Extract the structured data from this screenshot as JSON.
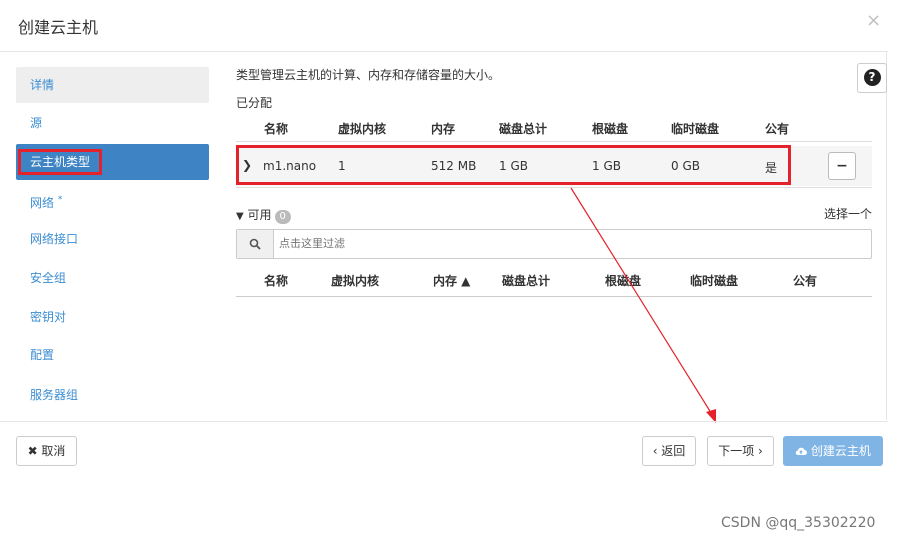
{
  "modal": {
    "title": "创建云主机",
    "close_icon": "×"
  },
  "sidebar": {
    "items": [
      {
        "label": "详情"
      },
      {
        "label": "源"
      },
      {
        "label": "云主机类型"
      },
      {
        "label": "网络",
        "required_mark": "*"
      },
      {
        "label": "网络接口"
      },
      {
        "label": "安全组"
      },
      {
        "label": "密钥对"
      },
      {
        "label": "配置"
      },
      {
        "label": "服务器组"
      }
    ]
  },
  "main": {
    "description": "类型管理云主机的计算、内存和存储容量的大小。",
    "help_glyph": "?",
    "allocated": {
      "label": "已分配",
      "columns": [
        "名称",
        "虚拟内核",
        "内存",
        "磁盘总计",
        "根磁盘",
        "临时磁盘",
        "公有"
      ],
      "row": {
        "expand": "❯",
        "name": "m1.nano",
        "vcpus": "1",
        "ram": "512 MB",
        "total_disk": "1 GB",
        "root_disk": "1 GB",
        "ephemeral_disk": "0 GB",
        "public": "是",
        "remove": "−"
      }
    },
    "available": {
      "toggle": "可用",
      "count": "0",
      "pick_hint": "选择一个",
      "search_placeholder": "点击这里过滤",
      "columns": [
        "名称",
        "虚拟内核",
        "内存 ▲",
        "磁盘总计",
        "根磁盘",
        "临时磁盘",
        "公有"
      ]
    }
  },
  "footer": {
    "cancel": "✖ 取消",
    "back": "‹ 返回",
    "next": "下一项 ›",
    "create": "创建云主机"
  },
  "watermark": "CSDN @qq_35302220",
  "colors": {
    "accent": "#3e84c5",
    "annotation_red": "#e4222b",
    "primary_disabled": "#7fb4e4"
  }
}
